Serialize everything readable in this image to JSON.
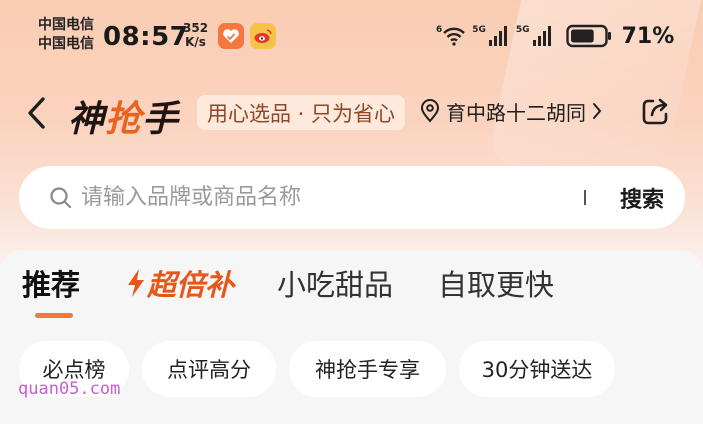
{
  "status_bar": {
    "carrier_1": "中国电信",
    "carrier_2": "中国电信",
    "time": "08:57",
    "net_speed_value": "352",
    "net_speed_unit": "K/s",
    "wifi_label": "6",
    "sim1_label": "5G",
    "sim2_label": "5G",
    "battery_percent": "71%",
    "battery_level": 0.71
  },
  "header": {
    "brand_part1": "神",
    "brand_part2": "抢",
    "brand_part3": "手",
    "slogan": "用心选品 · 只为省心",
    "location": "育中路十二胡同"
  },
  "search": {
    "placeholder": "请输入品牌或商品名称",
    "button_label": "搜索"
  },
  "tabs": [
    {
      "label": "推荐"
    },
    {
      "label": "超倍补"
    },
    {
      "label": "小吃甜品"
    },
    {
      "label": "自取更快"
    }
  ],
  "chips": [
    {
      "label": "必点榜"
    },
    {
      "label": "点评高分"
    },
    {
      "label": "神抢手专享"
    },
    {
      "label": "30分钟送达"
    }
  ],
  "watermark": "quan05.com",
  "colors": {
    "accent": "#e9561a",
    "indicator": "#f07a3b",
    "slogan_text": "#8a4a27"
  }
}
